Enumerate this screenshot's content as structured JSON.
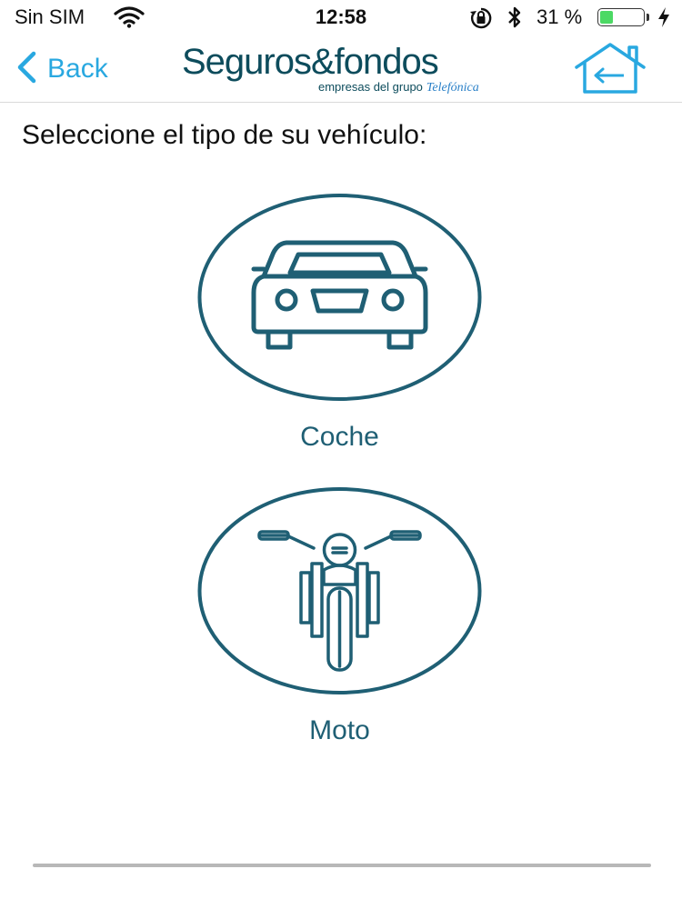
{
  "status_bar": {
    "carrier": "Sin SIM",
    "time": "12:58",
    "battery_percent": "31 %",
    "battery_level": 0.31,
    "icons": [
      "wifi-icon",
      "rotation-lock-icon",
      "bluetooth-icon",
      "battery-icon",
      "charging-bolt-icon"
    ]
  },
  "nav": {
    "back_label": "Back",
    "logo_main": "Seguros&fondos",
    "logo_sub": "empresas del grupo",
    "logo_brand": "Telefónica",
    "home_icon": "home-back-arrow-icon"
  },
  "colors": {
    "accent": "#29a8e0",
    "brand": "#0d4c5c",
    "vehicle": "#1f5f74"
  },
  "prompt": "Seleccione el tipo de su vehículo:",
  "vehicles": [
    {
      "label": "Coche",
      "icon": "car-icon"
    },
    {
      "label": "Moto",
      "icon": "motorcycle-icon"
    }
  ]
}
